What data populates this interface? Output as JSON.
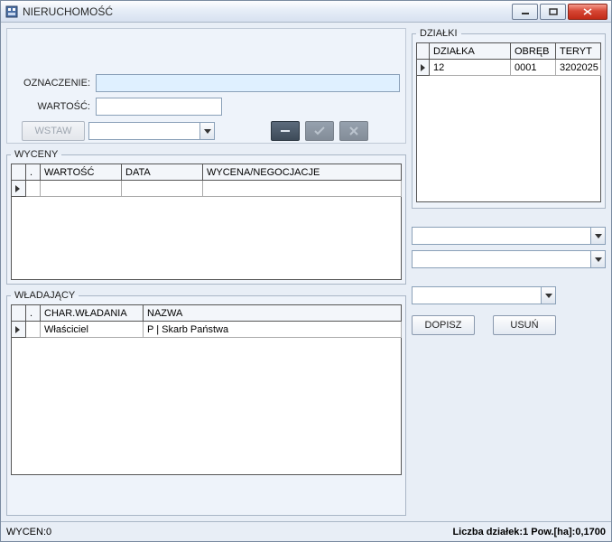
{
  "window": {
    "title": "NIERUCHOMOŚĆ"
  },
  "form": {
    "oznaczenie_label": "OZNACZENIE:",
    "wartosc_label": "WARTOŚĆ:",
    "oznaczenie_value": "",
    "wartosc_value": "",
    "wstaw_label": "WSTAW",
    "combo_value": ""
  },
  "toolbar": {
    "minus_label": "−",
    "check_label": "✓",
    "x_label": "✕"
  },
  "wyceny": {
    "legend": "WYCENY",
    "cols": {
      "idx": ".",
      "wartosc": "WARTOŚĆ",
      "data": "DATA",
      "wycneg": "WYCENA/NEGOCJACJE"
    }
  },
  "wladajacy": {
    "legend": "WŁADAJĄCY",
    "cols": {
      "idx": ".",
      "char": "CHAR.WŁADANIA",
      "nazwa": "NAZWA"
    },
    "row": {
      "char": "Właściciel",
      "nazwa": "P | Skarb Państwa"
    }
  },
  "dzialki": {
    "legend": "DZIAŁKI",
    "cols": {
      "dzialka": "DZIAŁKA",
      "obreb": "OBRĘB",
      "teryt": "TERYT"
    },
    "row": {
      "dzialka": "12",
      "obreb": "0001",
      "teryt": "3202025"
    }
  },
  "rightcombos": {
    "v1": "",
    "v2": "",
    "v3": ""
  },
  "rightbuttons": {
    "dopisz": "DOPISZ",
    "usun": "USUŃ"
  },
  "status": {
    "wycen": "WYCEN:0",
    "dzialki_info": "Liczba działek:1  Pow.[ha]:0,1700"
  }
}
